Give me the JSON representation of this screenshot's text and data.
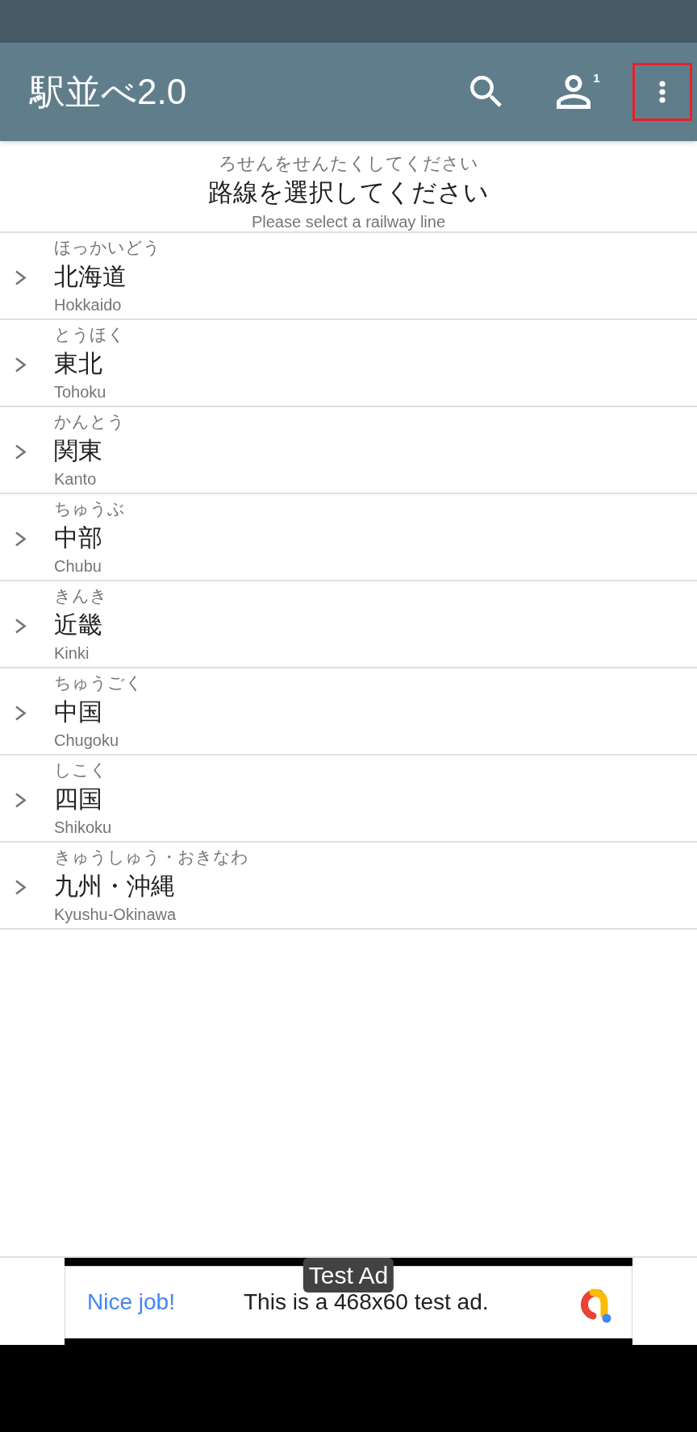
{
  "app_bar": {
    "title": "駅並べ2.0",
    "actions": [
      {
        "kind": "search",
        "highlighted": false
      },
      {
        "kind": "account",
        "badge": "1",
        "highlighted": false
      },
      {
        "kind": "more",
        "highlighted": true
      }
    ]
  },
  "header": {
    "reading": "ろせんをせんたくしてください",
    "title": "路線を選択してください",
    "subtitle": "Please select a railway line"
  },
  "regions": [
    {
      "reading": "ほっかいどう",
      "name": "北海道",
      "romaji": "Hokkaido",
      "expanded": false
    },
    {
      "reading": "とうほく",
      "name": "東北",
      "romaji": "Tohoku",
      "expanded": false
    },
    {
      "reading": "かんとう",
      "name": "関東",
      "romaji": "Kanto",
      "expanded": false
    },
    {
      "reading": "ちゅうぶ",
      "name": "中部",
      "romaji": "Chubu",
      "expanded": false
    },
    {
      "reading": "きんき",
      "name": "近畿",
      "romaji": "Kinki",
      "expanded": false
    },
    {
      "reading": "ちゅうごく",
      "name": "中国",
      "romaji": "Chugoku",
      "expanded": false
    },
    {
      "reading": "しこく",
      "name": "四国",
      "romaji": "Shikoku",
      "expanded": false
    },
    {
      "reading": "きゅうしゅう・おきなわ",
      "name": "九州・沖縄",
      "romaji": "Kyushu-Okinawa",
      "expanded": false
    }
  ],
  "ad": {
    "label": "Test Ad",
    "headline": "Nice job!",
    "text": "This is a 468x60 test ad."
  }
}
